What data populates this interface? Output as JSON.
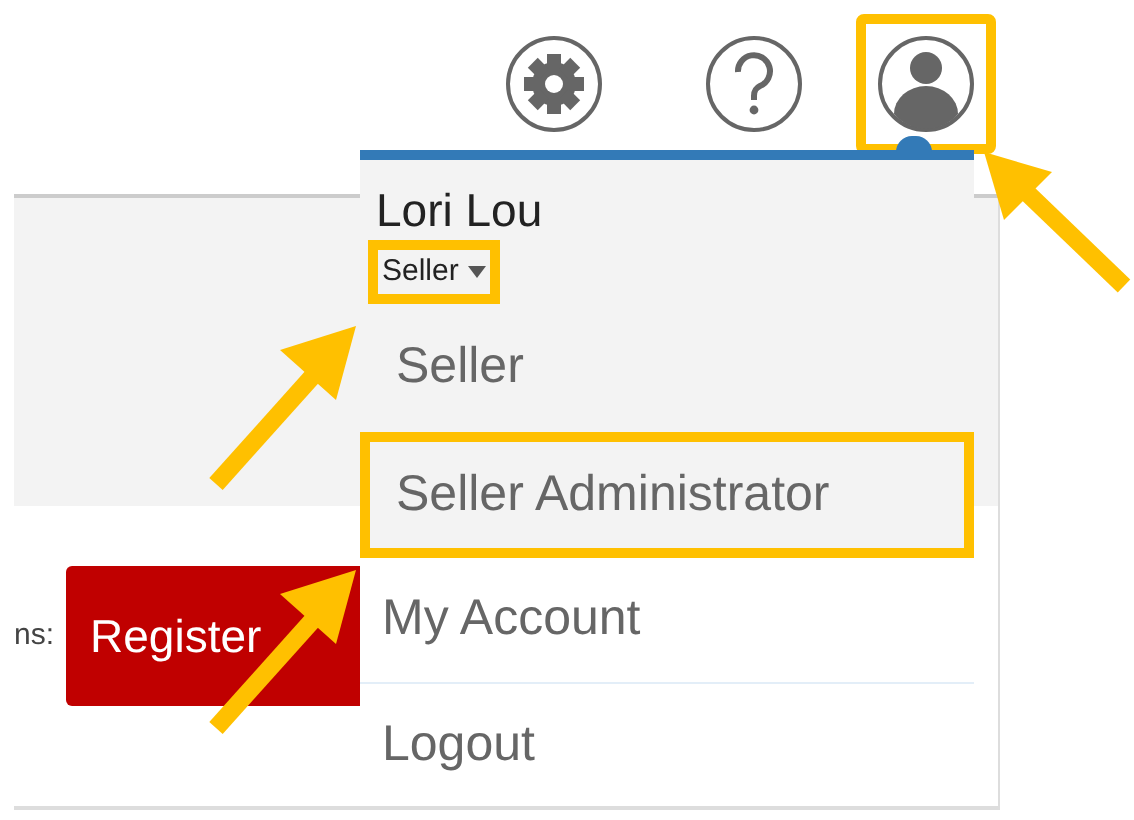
{
  "toolbar": {
    "buttons": [
      {
        "kind": "settings",
        "highlighted": false
      },
      {
        "kind": "help",
        "highlighted": false
      },
      {
        "kind": "profile",
        "highlighted": true
      }
    ]
  },
  "page": {
    "label": "ns:",
    "register_button": "Register"
  },
  "user_menu": {
    "name": "Lori Lou",
    "role": {
      "label": "Seller",
      "highlighted": true
    },
    "roles": [
      {
        "label": "Seller",
        "highlighted": false
      },
      {
        "label": "Seller Administrator",
        "highlighted": true
      }
    ],
    "links": [
      {
        "label": "My Account"
      },
      {
        "label": "Logout"
      }
    ]
  }
}
